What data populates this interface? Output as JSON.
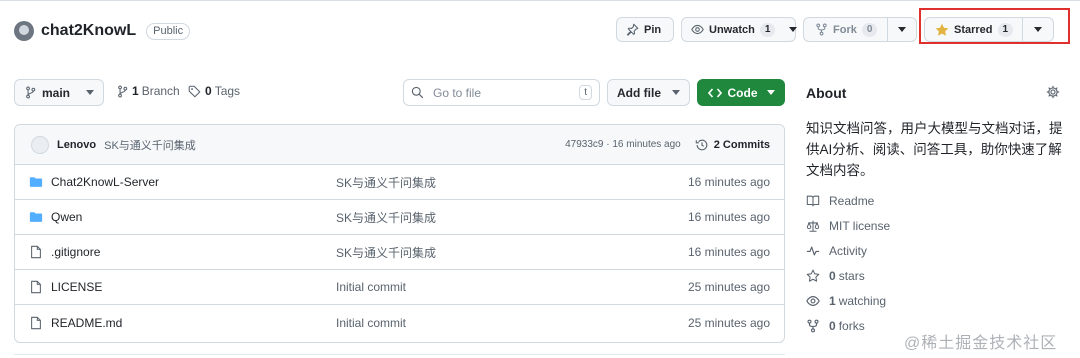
{
  "repo": {
    "name": "chat2KnowL",
    "visibility": "Public"
  },
  "header_actions": {
    "pin_label": "Pin",
    "unwatch_label": "Unwatch",
    "unwatch_count": "1",
    "fork_label": "Fork",
    "fork_count": "0",
    "starred_label": "Starred",
    "star_count": "1"
  },
  "toolbar": {
    "branch": "main",
    "branches_count": "1",
    "branches_label": "Branch",
    "tags_count": "0",
    "tags_label": "Tags",
    "search_placeholder": "Go to file",
    "search_shortcut": "t",
    "add_file_label": "Add file",
    "code_label": "Code"
  },
  "latest_commit": {
    "author": "Lenovo",
    "message": "SK与通义千问集成",
    "meta": "47933c9 · 16 minutes ago",
    "commits_label": "2 Commits"
  },
  "files": [
    {
      "type": "folder",
      "name": "Chat2KnowL-Server",
      "message": "SK与通义千问集成",
      "time": "16 minutes ago"
    },
    {
      "type": "folder",
      "name": "Qwen",
      "message": "SK与通义千问集成",
      "time": "16 minutes ago"
    },
    {
      "type": "file",
      "name": ".gitignore",
      "message": "SK与通义千问集成",
      "time": "16 minutes ago"
    },
    {
      "type": "file",
      "name": "LICENSE",
      "message": "Initial commit",
      "time": "25 minutes ago"
    },
    {
      "type": "file",
      "name": "README.md",
      "message": "Initial commit",
      "time": "25 minutes ago"
    }
  ],
  "about": {
    "title": "About",
    "description": "知识文档问答，用户大模型与文档对话，提供AI分析、阅读、问答工具，助你快速了解文档内容。",
    "readme_label": "Readme",
    "license_label": "MIT license",
    "activity_label": "Activity",
    "stars_count": "0",
    "stars_label": "stars",
    "watching_count": "1",
    "watching_label": "watching",
    "forks_count": "0",
    "forks_label": "forks"
  },
  "watermark": "@稀土掘金技术社区",
  "colors": {
    "accent_green": "#1f883d",
    "folder_blue": "#54aeff",
    "star_yellow": "#e3b341",
    "highlight_red": "#e0302e"
  }
}
